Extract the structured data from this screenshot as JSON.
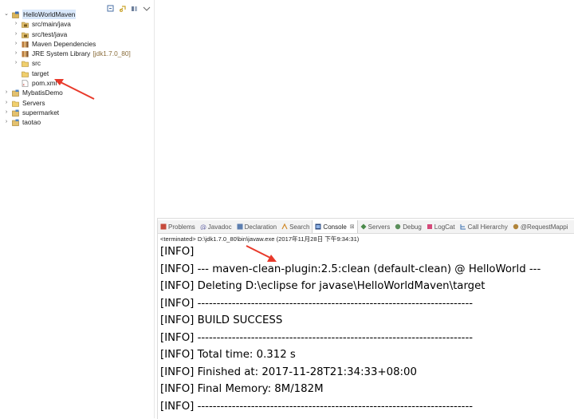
{
  "explorer": {
    "toolbar_icons": [
      "collapse-all-icon",
      "link-with-editor-icon",
      "view-menu-icon",
      "minimize-icon"
    ],
    "tree": [
      {
        "label": "HelloWorldMaven",
        "icon": "maven-project-icon",
        "level": 0,
        "expanded": true,
        "selected": true
      },
      {
        "label": "src/main/java",
        "icon": "source-folder-icon",
        "level": 1,
        "expanded": false
      },
      {
        "label": "src/test/java",
        "icon": "source-folder-icon",
        "level": 1,
        "expanded": false
      },
      {
        "label": "Maven Dependencies",
        "icon": "library-icon",
        "level": 1,
        "expanded": false
      },
      {
        "label": "JRE System Library",
        "decoration": "[jdk1.7.0_80]",
        "icon": "library-icon",
        "level": 1,
        "expanded": false
      },
      {
        "label": "src",
        "icon": "folder-icon",
        "level": 1,
        "expanded": false
      },
      {
        "label": "target",
        "icon": "folder-icon",
        "level": 1,
        "leaf": true
      },
      {
        "label": "pom.xml",
        "icon": "xml-file-icon",
        "level": 1,
        "leaf": true
      },
      {
        "label": "MybatisDemo",
        "icon": "project-icon",
        "level": 0,
        "expanded": false
      },
      {
        "label": "Servers",
        "icon": "folder-icon",
        "level": 0,
        "expanded": false
      },
      {
        "label": "supermarket",
        "icon": "project-icon",
        "level": 0,
        "expanded": false
      },
      {
        "label": "taotao",
        "icon": "project-icon",
        "level": 0,
        "expanded": false
      }
    ]
  },
  "views": {
    "tabs": [
      {
        "label": "Problems",
        "icon": "problems-icon",
        "active": false
      },
      {
        "label": "Javadoc",
        "icon": "javadoc-icon",
        "active": false
      },
      {
        "label": "Declaration",
        "icon": "declaration-icon",
        "active": false
      },
      {
        "label": "Search",
        "icon": "search-icon",
        "active": false
      },
      {
        "label": "Console",
        "icon": "console-icon",
        "active": true,
        "close": "⊠"
      },
      {
        "label": "Servers",
        "icon": "servers-icon",
        "active": false
      },
      {
        "label": "Debug",
        "icon": "debug-icon",
        "active": false
      },
      {
        "label": "LogCat",
        "icon": "logcat-icon",
        "active": false
      },
      {
        "label": "Call Hierarchy",
        "icon": "call-hierarchy-icon",
        "active": false
      },
      {
        "label": "@RequestMappi",
        "icon": "request-mapping-icon",
        "active": false
      }
    ]
  },
  "console": {
    "status": "<terminated> D:\\jdk1.7.0_80\\bin\\javaw.exe (2017年11月28日 下午9:34:31)",
    "lines": [
      "[INFO]",
      "[INFO] --- maven-clean-plugin:2.5:clean (default-clean) @ HelloWorld ---",
      "[INFO] Deleting D:\\eclipse for javase\\HelloWorldMaven\\target",
      "[INFO] ------------------------------------------------------------------------",
      "[INFO] BUILD SUCCESS",
      "[INFO] ------------------------------------------------------------------------",
      "[INFO] Total time: 0.312 s",
      "[INFO] Finished at: 2017-11-28T21:34:33+08:00",
      "[INFO] Final Memory: 8M/182M",
      "[INFO] ------------------------------------------------------------------------"
    ]
  },
  "colors": {
    "selection": "#d9e8fb",
    "arrow": "#e8392a",
    "decoration": "#8a6d3b"
  }
}
